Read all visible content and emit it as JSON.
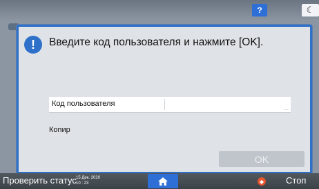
{
  "topbar": {
    "help_label": "?",
    "night_mode_glyph": "☾"
  },
  "dialog": {
    "title": "Введите код пользователя и нажмите [OK].",
    "field_label": "Код пользователя",
    "field_value": "",
    "field_more": "...",
    "function_label": "Копир",
    "ok_label": "OK",
    "ok_enabled": false
  },
  "bottombar": {
    "status_label": "Проверить статус",
    "date": "15 Дек. 2020",
    "time": "10 : 23",
    "stop_label": "Стоп"
  },
  "colors": {
    "accent": "#2f71c9",
    "stop": "#e8542c",
    "ok_disabled": "#bfc5cb"
  }
}
